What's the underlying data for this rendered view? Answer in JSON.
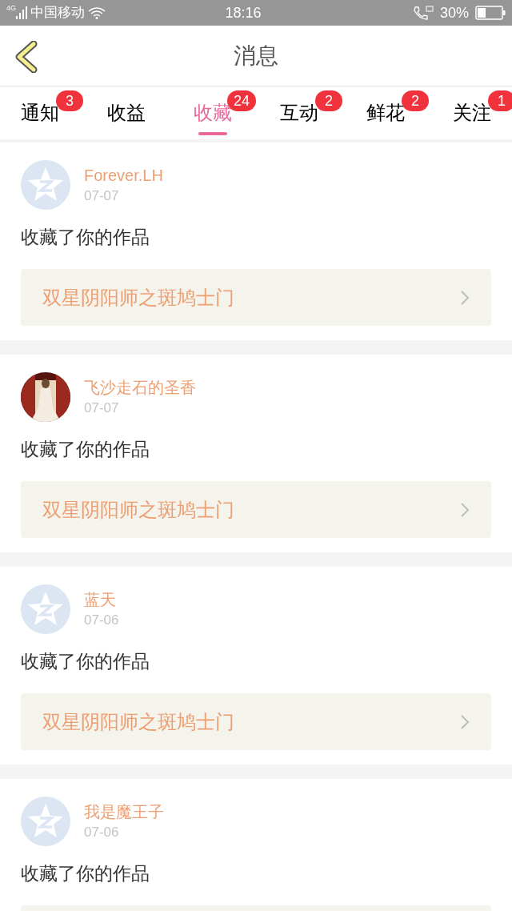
{
  "status_bar": {
    "network": "4G",
    "carrier": "中国移动",
    "time": "18:16",
    "battery": "30%"
  },
  "header": {
    "title": "消息"
  },
  "tabs": [
    {
      "label": "通知",
      "badge": "3",
      "selected": false
    },
    {
      "label": "收益",
      "selected": false
    },
    {
      "label": "收藏",
      "badge": "24",
      "selected": true
    },
    {
      "label": "互动",
      "badge": "2",
      "selected": false
    },
    {
      "label": "鲜花",
      "badge": "2",
      "selected": false
    },
    {
      "label": "关注",
      "badge": "1",
      "selected": false
    }
  ],
  "messages": [
    {
      "avatar": {
        "kind": "default"
      },
      "name": "Forever.LH",
      "date": "07-07",
      "action": "收藏了你的作品",
      "work": "双星阴阳师之斑鸠士门"
    },
    {
      "name": "飞沙走石的圣香",
      "date": "07-07",
      "action": "收藏了你的作品",
      "work": "双星阴阳师之斑鸠士门"
    },
    {
      "avatar": {
        "kind": "default"
      },
      "name": "蓝天",
      "date": "07-06",
      "action": "收藏了你的作品",
      "work": "双星阴阳师之斑鸠士门"
    },
    {
      "avatar": {
        "kind": "default"
      },
      "name": "我是魔王子",
      "date": "07-06",
      "action": "收藏了你的作品"
    }
  ]
}
